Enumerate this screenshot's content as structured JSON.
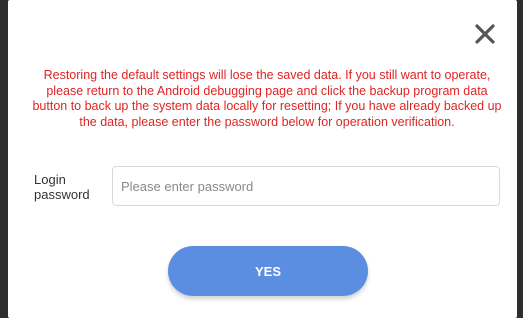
{
  "dialog": {
    "close_icon": "close-icon",
    "message": "Restoring the default settings will lose the saved data. If you still want to operate, please return to the Android debugging page and click the backup program data button to back up the system data locally for resetting; If you have already backed up the data, please enter the password below for operation verification.",
    "password_label": "Login password",
    "password_value": "",
    "password_placeholder": "Please enter password",
    "confirm_label": "YES"
  },
  "colors": {
    "warning_text": "#e02424",
    "button": "#5b8de1",
    "backdrop": "#2e2e2e"
  }
}
